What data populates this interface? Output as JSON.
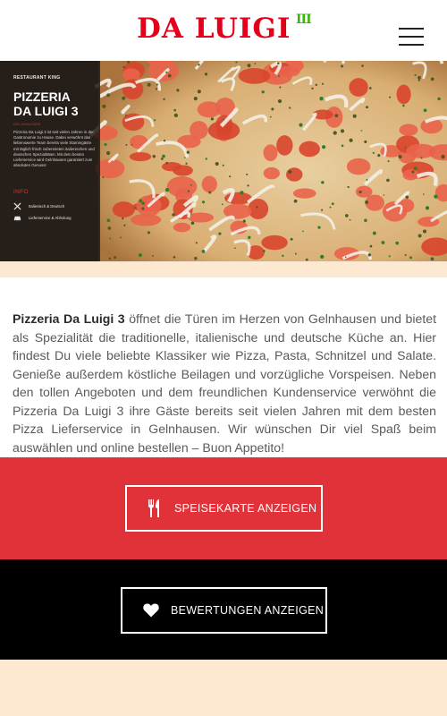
{
  "header": {
    "logo_text": "DA LUIGI",
    "logo_superscript": "III",
    "menu_icon": "hamburger-menu-icon"
  },
  "hero": {
    "panel": {
      "kicker": "RESTAURANT KING",
      "title_line1": "PIZZERIA",
      "title_line2": "DA LUIGI 3",
      "city": "GELNHAUSEN",
      "description": "Pizzeria Da Luigi 3 ist seit vielen Jahren in der Gastronomie zu Hause. Dabei verwöhnt das liebenswerte Team bereits viele Stammgäste mit täglich frisch zubereiteten italienischen und deutschen Spezialitäten. Mit dem besten Lieferservice wird Gelnhausen garantiert zum absoluten Genuss!",
      "info_heading": "INFO",
      "info_rows": [
        {
          "icon": "cutlery-icon",
          "label": "Italienisch & Deutsch"
        },
        {
          "icon": "car-icon",
          "label": "Lieferservice & Abholung"
        }
      ]
    }
  },
  "intro": {
    "brand": "Pizzeria Da Luigi 3",
    "text": " öffnet die Türen im Herzen von Gelnhausen und bietet als Spezialität die traditionelle, italienische und deutsche Küche an. Hier findest Du viele beliebte Klassiker wie Pizza, Pasta, Schnitzel und Salate. Genieße außerdem köstliche Beilagen und vorzügliche Vorspeisen. Neben den tollen Angeboten und dem freundlichen Kundenservice verwöhnt die Pizzeria Da Luigi 3 ihre Gäste bereits seit vielen Jahren mit dem besten Pizza Lieferservice in Gelnhausen.  Wir wünschen Dir viel Spaß beim auswählen und online bestellen – Buon Appetito!"
  },
  "buttons": {
    "menu_label": "SPEISEKARTE ANZEIGEN",
    "menu_icon": "fork-knife-icon",
    "reviews_label": "BEWERTUNGEN ANZEIGEN",
    "reviews_icon": "heart-icon"
  },
  "colors": {
    "brand_red": "#e2001a",
    "logo_green": "#3cb40a",
    "section_red": "#e1323a",
    "section_black": "#000000",
    "cream": "#fde9d2"
  }
}
